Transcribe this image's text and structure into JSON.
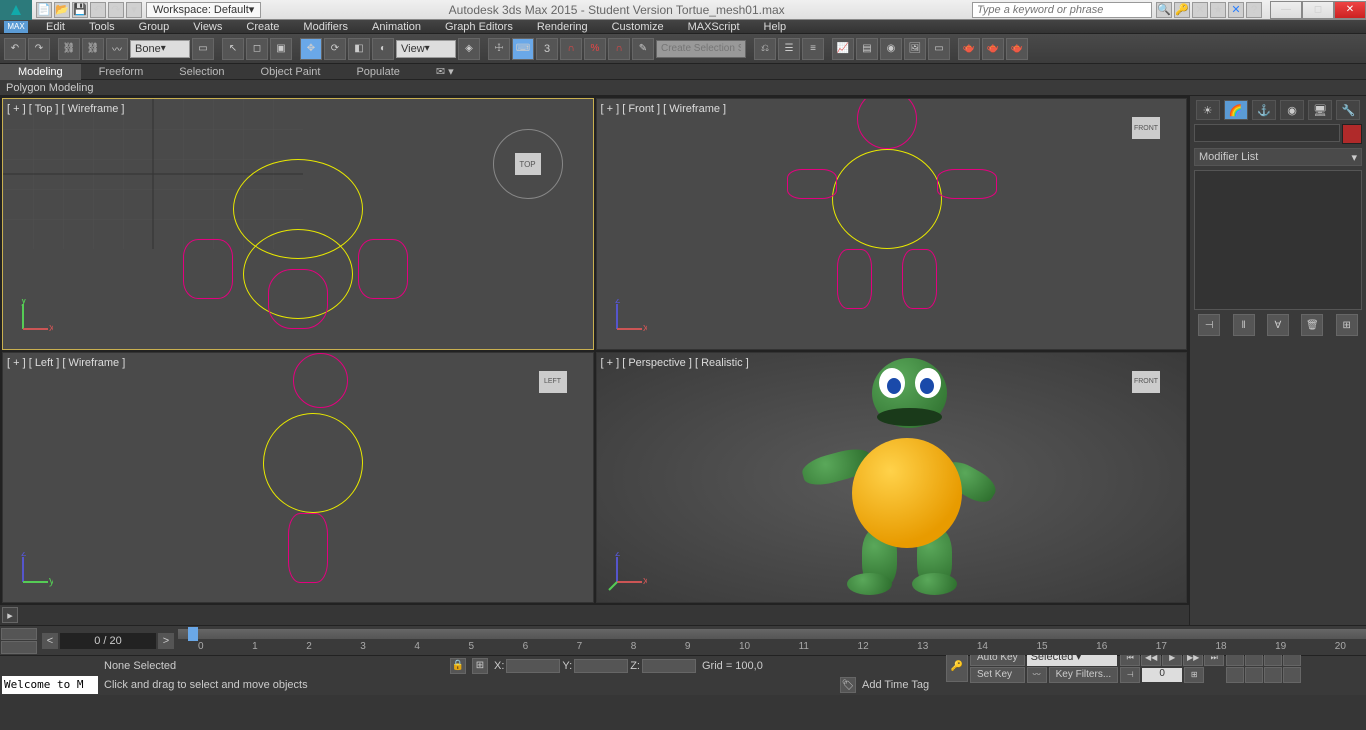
{
  "titlebar": {
    "workspace_label": "Workspace: Default",
    "app_title": "Autodesk 3ds Max 2015 - Student Version    Tortue_mesh01.max",
    "search_placeholder": "Type a keyword or phrase"
  },
  "menu": {
    "items": [
      "Edit",
      "Tools",
      "Group",
      "Views",
      "Create",
      "Modifiers",
      "Animation",
      "Graph Editors",
      "Rendering",
      "Customize",
      "MAXScript",
      "Help"
    ],
    "logo": "MAX"
  },
  "toolbar": {
    "bone_dropdown": "Bone",
    "view_dropdown": "View",
    "snap_value": "3",
    "selection_set_placeholder": "Create Selection Se"
  },
  "ribbon": {
    "tabs": [
      "Modeling",
      "Freeform",
      "Selection",
      "Object Paint",
      "Populate"
    ],
    "active": "Modeling",
    "sub": "Polygon Modeling"
  },
  "viewports": {
    "top": {
      "label": "[ + ] [ Top ] [ Wireframe ]",
      "cube": "TOP"
    },
    "front": {
      "label": "[ + ] [ Front ] [ Wireframe ]",
      "cube": "FRONT"
    },
    "left": {
      "label": "[ + ] [ Left ] [ Wireframe ]",
      "cube": "LEFT"
    },
    "persp": {
      "label": "[ + ] [ Perspective ] [ Realistic ]",
      "cube": "FRONT"
    }
  },
  "panel": {
    "modifier_list": "Modifier List"
  },
  "timeline": {
    "frame_display": "0 / 20",
    "ticks": [
      "0",
      "1",
      "2",
      "3",
      "4",
      "5",
      "6",
      "7",
      "8",
      "9",
      "10",
      "11",
      "12",
      "13",
      "14",
      "15",
      "16",
      "17",
      "18",
      "19",
      "20"
    ]
  },
  "status": {
    "welcome": "Welcome to M",
    "selection": "None Selected",
    "hint": "Click and drag to select and move objects",
    "x_label": "X:",
    "y_label": "Y:",
    "z_label": "Z:",
    "grid": "Grid = 100,0",
    "add_time_tag": "Add Time Tag",
    "auto_key": "Auto Key",
    "set_key": "Set Key",
    "selected_drop": "Selected",
    "key_filters": "Key Filters...",
    "frame_spin": "0"
  }
}
